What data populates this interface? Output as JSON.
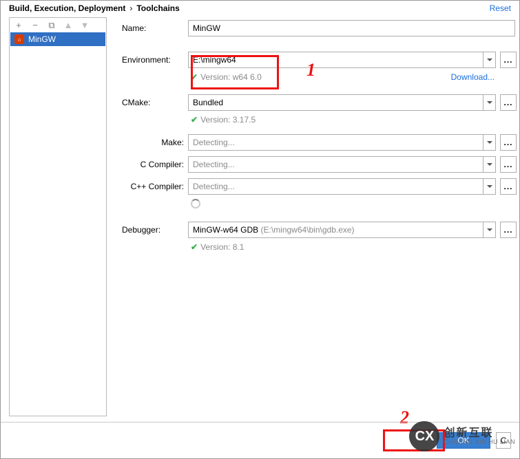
{
  "breadcrumb": {
    "parent": "Build, Execution, Deployment",
    "current": "Toolchains",
    "reset": "Reset"
  },
  "sidebar": {
    "items": [
      "MinGW"
    ]
  },
  "form": {
    "name_label": "Name:",
    "name_value": "MinGW",
    "env_label": "Environment:",
    "env_value": "E:\\mingw64",
    "env_version": "Version: w64 6.0",
    "download": "Download...",
    "cmake_label": "CMake:",
    "cmake_value": "Bundled",
    "cmake_version": "Version: 3.17.5",
    "make_label": "Make:",
    "make_value": "Detecting...",
    "cc_label": "C Compiler:",
    "cc_value": "Detecting...",
    "cxx_label": "C++ Compiler:",
    "cxx_value": "Detecting...",
    "dbg_label": "Debugger:",
    "dbg_value_main": "MinGW-w64 GDB",
    "dbg_value_hint": "(E:\\mingw64\\bin\\gdb.exe)",
    "dbg_version": "Version: 8.1"
  },
  "buttons": {
    "ok": "OK",
    "cancel": "C",
    "ell": "..."
  },
  "annotations": {
    "one": "1",
    "two": "2"
  },
  "watermark": {
    "cn": "创新互联",
    "en": "CHUANG XIN HU LIAN"
  }
}
